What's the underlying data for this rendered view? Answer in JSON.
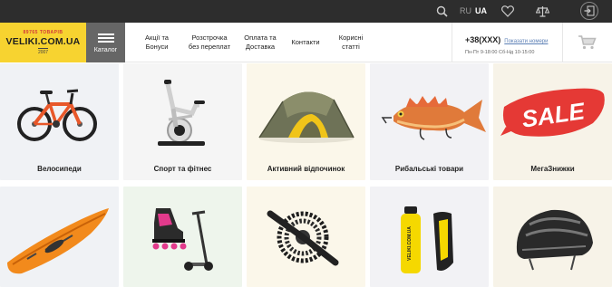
{
  "topbar": {
    "icons": [
      "search-icon",
      "heart-icon",
      "scales-icon",
      "login-icon"
    ],
    "lang_ru": "RU",
    "lang_ua": "UA"
  },
  "logo": {
    "top": "89765 ТОВАРІВ",
    "name": "VELIKI.COM.UA",
    "year": "2007"
  },
  "catalog": {
    "label": "Каталог"
  },
  "nav": [
    {
      "label": "Акції та\nБонуси"
    },
    {
      "label": "Розстрочка\nбез переплат"
    },
    {
      "label": "Оплата та\nДоставка"
    },
    {
      "label": "Контакти"
    },
    {
      "label": "Корисні\nстатті"
    }
  ],
  "contact": {
    "phone": "+38(XXX)",
    "show_number": "Показати номери",
    "hours": "Пн-Пт 9-18:00 Сб-Нд 10-15:00"
  },
  "categories": [
    {
      "label": "Велосипеди",
      "bg": "#f0f2f5"
    },
    {
      "label": "Спорт та фітнес",
      "bg": "#f5f5f5"
    },
    {
      "label": "Активний відпочинок",
      "bg": "#fbf7ea"
    },
    {
      "label": "Рибальські товари",
      "bg": "#f2f2f5"
    },
    {
      "label": "МегаЗнижки",
      "bg": "#f7f3e8"
    },
    {
      "label": "",
      "bg": "#f0f2f5"
    },
    {
      "label": "",
      "bg": "#eef5ec"
    },
    {
      "label": "",
      "bg": "#fbf7ea"
    },
    {
      "label": "",
      "bg": "#f2f2f5"
    },
    {
      "label": "",
      "bg": "#f7f3e8"
    }
  ],
  "sale_text": "SALE",
  "bottle_text": "VELIKI.COM.UA",
  "colors": {
    "topbar": "#2d2d2d",
    "logo": "#f7d330",
    "catalog": "#666666",
    "accent_red": "#e53935"
  }
}
